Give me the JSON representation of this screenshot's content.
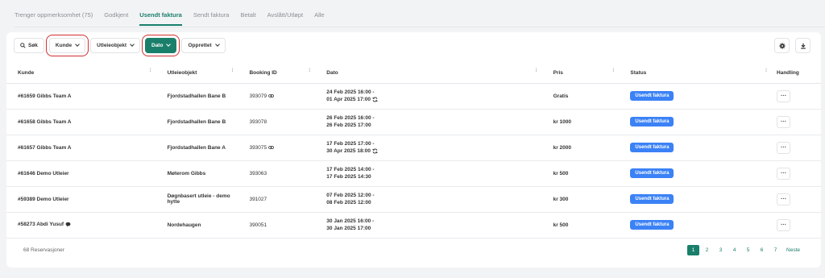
{
  "tabs": [
    {
      "label": "Trenger oppmerksomhet (75)",
      "active": false
    },
    {
      "label": "Godkjent",
      "active": false
    },
    {
      "label": "Usendt faktura",
      "active": true
    },
    {
      "label": "Sendt faktura",
      "active": false
    },
    {
      "label": "Betalt",
      "active": false
    },
    {
      "label": "Avslått/Utløpt",
      "active": false
    },
    {
      "label": "Alle",
      "active": false
    }
  ],
  "filters": {
    "search": "Søk",
    "kunde": "Kunde",
    "utleieobjekt": "Utleieobjekt",
    "dato": "Dato",
    "opprettet": "Opprettet"
  },
  "columns": [
    "Kunde",
    "Utleieobjekt",
    "Booking ID",
    "Dato",
    "Pris",
    "Status",
    "Handling"
  ],
  "rows": [
    {
      "kunde": "#61659 Gibbs Team A",
      "objekt": "Fjordstadhallen Bane B",
      "booking": "393079",
      "linked": true,
      "dato1": "24 Feb 2025 16:00 -",
      "dato2": "01 Apr 2025 17:00",
      "repeat": true,
      "pris": "Gratis",
      "status": "Usendt faktura",
      "chat": false
    },
    {
      "kunde": "#61658 Gibbs Team A",
      "objekt": "Fjordstadhallen Bane B",
      "booking": "393078",
      "linked": false,
      "dato1": "26 Feb 2025 16:00 -",
      "dato2": "26 Feb 2025 17:00",
      "repeat": false,
      "pris": "kr 1000",
      "status": "Usendt faktura",
      "chat": false
    },
    {
      "kunde": "#61657 Gibbs Team A",
      "objekt": "Fjordstadhallen Bane A",
      "booking": "393075",
      "linked": true,
      "dato1": "17 Feb 2025 17:00 -",
      "dato2": "30 Apr 2025 18:00",
      "repeat": true,
      "pris": "kr 2000",
      "status": "Usendt faktura",
      "chat": false
    },
    {
      "kunde": "#61646 Demo Utleier",
      "objekt": "Møterom Gibbs",
      "booking": "393063",
      "linked": false,
      "dato1": "17 Feb 2025 14:00 -",
      "dato2": "17 Feb 2025 14:30",
      "repeat": false,
      "pris": "kr 500",
      "status": "Usendt faktura",
      "chat": false
    },
    {
      "kunde": "#59389 Demo Utleier",
      "objekt": "Døgnbasert utleie - demo hytte",
      "booking": "391027",
      "linked": false,
      "dato1": "07 Feb 2025 12:00 -",
      "dato2": "08 Feb 2025 12:00",
      "repeat": false,
      "pris": "kr 300",
      "status": "Usendt faktura",
      "chat": false
    },
    {
      "kunde": "#58273 Abdi Yusuf",
      "objekt": "Nordehaugen",
      "booking": "390051",
      "linked": false,
      "dato1": "30 Jan 2025 16:00 -",
      "dato2": "30 Jan 2025 17:00",
      "repeat": false,
      "pris": "kr 500",
      "status": "Usendt faktura",
      "chat": true
    }
  ],
  "footer": {
    "count": "68 Reservasjoner",
    "pages": [
      "1",
      "2",
      "3",
      "4",
      "5",
      "6",
      "7"
    ],
    "next": "Neste"
  },
  "colors": {
    "accent": "#1a7f6a",
    "status": "#3b82f6",
    "highlight": "#d32f2f"
  }
}
